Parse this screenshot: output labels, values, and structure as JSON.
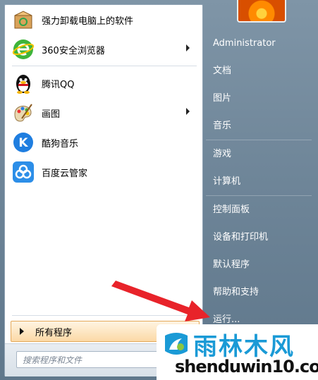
{
  "left_panel": {
    "programs": [
      {
        "label": "强力卸载电脑上的软件",
        "icon": "uninstall-box-icon",
        "has_submenu": false
      },
      {
        "label": "360安全浏览器",
        "icon": "360-browser-icon",
        "has_submenu": true
      },
      {
        "label": "腾讯QQ",
        "icon": "qq-penguin-icon",
        "has_submenu": false
      },
      {
        "label": "画图",
        "icon": "paint-palette-icon",
        "has_submenu": true
      },
      {
        "label": "酷狗音乐",
        "icon": "kugou-icon",
        "has_submenu": false
      },
      {
        "label": "百度云管家",
        "icon": "baidu-cloud-icon",
        "has_submenu": false
      }
    ],
    "all_programs_label": "所有程序",
    "search_placeholder": "搜索程序和文件"
  },
  "right_panel": {
    "username": "Administrator",
    "items": [
      {
        "label": "文档"
      },
      {
        "label": "图片"
      },
      {
        "label": "音乐"
      },
      {
        "label": "游戏"
      },
      {
        "label": "计算机"
      },
      {
        "label": "控制面板"
      },
      {
        "label": "设备和打印机"
      },
      {
        "label": "默认程序"
      },
      {
        "label": "帮助和支持"
      },
      {
        "label": "运行..."
      }
    ]
  },
  "watermark": {
    "title": "雨林木风",
    "url": "shenduwin10.com"
  },
  "colors": {
    "accent_arrow": "#e8232a",
    "watermark_blue": "#1a9ad6",
    "all_programs_highlight": "#fbd9a6"
  }
}
